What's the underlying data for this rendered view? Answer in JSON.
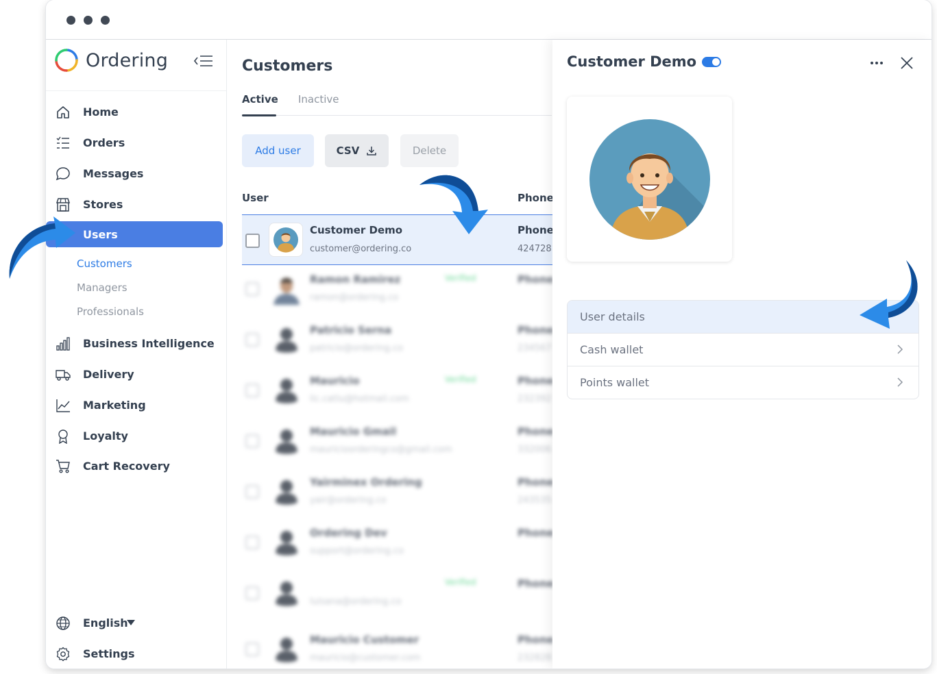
{
  "brand": {
    "name": "Ordering"
  },
  "sidebar": {
    "items": [
      {
        "label": "Home",
        "icon": "home-icon"
      },
      {
        "label": "Orders",
        "icon": "list-icon"
      },
      {
        "label": "Messages",
        "icon": "chat-icon"
      },
      {
        "label": "Stores",
        "icon": "store-icon"
      },
      {
        "label": "Users",
        "icon": "user-icon",
        "active": true
      },
      {
        "label": "Business Intelligence",
        "icon": "bar-chart-icon"
      },
      {
        "label": "Delivery",
        "icon": "truck-icon"
      },
      {
        "label": "Marketing",
        "icon": "line-chart-icon"
      },
      {
        "label": "Loyalty",
        "icon": "award-icon"
      },
      {
        "label": "Cart Recovery",
        "icon": "cart-icon"
      }
    ],
    "subitems": [
      {
        "label": "Customers",
        "active": true
      },
      {
        "label": "Managers"
      },
      {
        "label": "Professionals"
      }
    ],
    "language": "English",
    "settings": "Settings"
  },
  "content": {
    "title": "Customers",
    "tabs": [
      "Active",
      "Inactive"
    ],
    "buttons": {
      "add": "Add user",
      "csv": "CSV",
      "delete": "Delete"
    },
    "columns": {
      "user": "User",
      "phone": "Phone"
    },
    "selected_row": {
      "name": "Customer Demo",
      "email": "customer@ordering.co",
      "phone_label": "Phone",
      "phone": "424728"
    },
    "rows": [
      {
        "name": "Ramon Ramirez",
        "email": "ramon@ordering.co",
        "verified": "Verified",
        "phone_label": "Phone",
        "phone": ""
      },
      {
        "name": "Patricio Serna",
        "email": "patricio@ordering.co",
        "verified": "",
        "phone_label": "Phone",
        "phone": "234567"
      },
      {
        "name": "Mauricio",
        "email": "lic.catlu@hotmail.com",
        "verified": "Verified",
        "phone_label": "Phone",
        "phone": "232392"
      },
      {
        "name": "Mauricio Gmail",
        "email": "mauricioorderingco@gmail.com",
        "verified": "",
        "phone_label": "Phone",
        "phone": "332006"
      },
      {
        "name": "Yairminex Ordering",
        "email": "yair@ordering.co",
        "verified": "",
        "phone_label": "Phone",
        "phone": "243535"
      },
      {
        "name": "Ordering Dev",
        "email": "support@ordering.co",
        "verified": "",
        "phone_label": "Phone",
        "phone": ""
      },
      {
        "name": "",
        "email": "luisana@ordering.co",
        "verified": "Verified",
        "phone_label": "Phone",
        "phone": ""
      },
      {
        "name": "Mauricio Customer",
        "email": "mauricio@customer.com",
        "verified": "",
        "phone_label": "Phone",
        "phone": "232828"
      }
    ]
  },
  "panel": {
    "title": "Customer Demo",
    "menu": [
      "User details",
      "Cash wallet",
      "Points wallet"
    ]
  },
  "colors": {
    "accent": "#2c7be5",
    "active_nav": "#4a7ee3",
    "arrow": "#2c8be8",
    "text": "#344050"
  }
}
